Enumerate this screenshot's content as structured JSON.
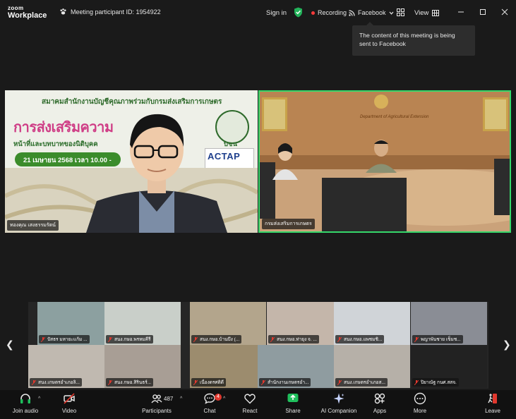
{
  "app": {
    "logo_top": "zoom",
    "logo_bottom": "Workplace"
  },
  "titlebar": {
    "meeting_id": "Meeting participant ID: 1954922",
    "signin": "Sign in",
    "recording": "Recording",
    "facebook": "Facebook",
    "view": "View"
  },
  "tooltip": {
    "text": "The content of this meeting is being sent to Facebook"
  },
  "main_videos": [
    {
      "name": "ทองคุณ เสงธรรมรัตน์",
      "slide": {
        "top": "สมาคมสำนักงานบัญชีคุณภาพร่วมกับกรมส่งเสริมการเกษตร",
        "title": "การส่งเสริมความ",
        "sub": "หน้าที่และบทบาทของนิติบุคค",
        "sub_tail": "บชน",
        "date": "21 เมษายน 2568 เวลา 10.00 -",
        "logo": "ACTAP"
      }
    },
    {
      "name": "กรมส่งเสริมการเกษตร",
      "room_title": "Department of Agricultural Extension"
    }
  ],
  "gallery": [
    {
      "name": "ปัสธร มหายะแก้ม ..."
    },
    {
      "name": "สนง.กษอ.พรหมคีรี"
    },
    {
      "name": "สนง.กษอ.บ้านบึง (..."
    },
    {
      "name": "สนง.กษอ.ท่ายุง จ. ..."
    },
    {
      "name": "สนง.กษอ.แพชมชิ..."
    },
    {
      "name": "พญาพันชาย เข็มช..."
    },
    {
      "name": "สนง.เกษตรอำเภอลิ..."
    },
    {
      "name": "สนง.กษอ.สิรินธร์..."
    },
    {
      "name": "เนื่องดรศติดี"
    },
    {
      "name": "สำนักงานเกษตรอำ..."
    },
    {
      "name": "สนง.เกษตรอำเภอส..."
    },
    {
      "name": "ปิยาณัฐ กนศ.สสจ."
    }
  ],
  "toolbar": {
    "join_audio": "Join audio",
    "video": "Video",
    "participants": "Participants",
    "participants_count": "487",
    "chat": "Chat",
    "chat_badge": "4",
    "react": "React",
    "share": "Share",
    "ai": "AI Companion",
    "apps": "Apps",
    "more": "More",
    "leave": "Leave"
  },
  "colors": {
    "active_speaker": "#36d86a",
    "share": "#1fbf5c",
    "leave": "#e0382e",
    "recording": "#ff3b3b"
  }
}
